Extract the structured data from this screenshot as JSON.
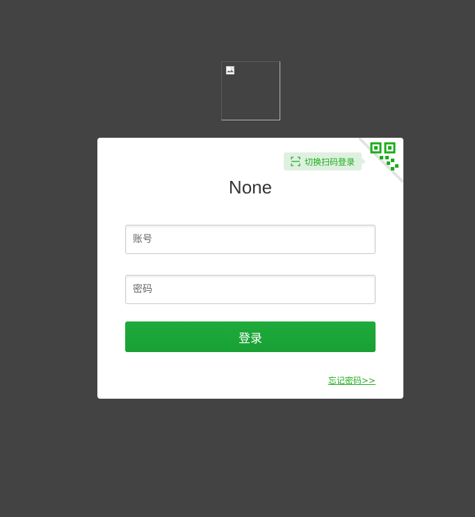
{
  "logo": {
    "icon": "broken-image-icon"
  },
  "qr_switch": {
    "label": "切换扫码登录",
    "icon": "scan-icon",
    "corner_icon": "qr-code-icon"
  },
  "login": {
    "title": "None",
    "account_placeholder": "账号",
    "password_placeholder": "密码",
    "submit_label": "登录",
    "forgot_label": "忘记密码>>"
  },
  "colors": {
    "background": "#434343",
    "brand_green": "#1aad19",
    "button_green": "#1aa337",
    "tip_background": "#dff0e0"
  }
}
